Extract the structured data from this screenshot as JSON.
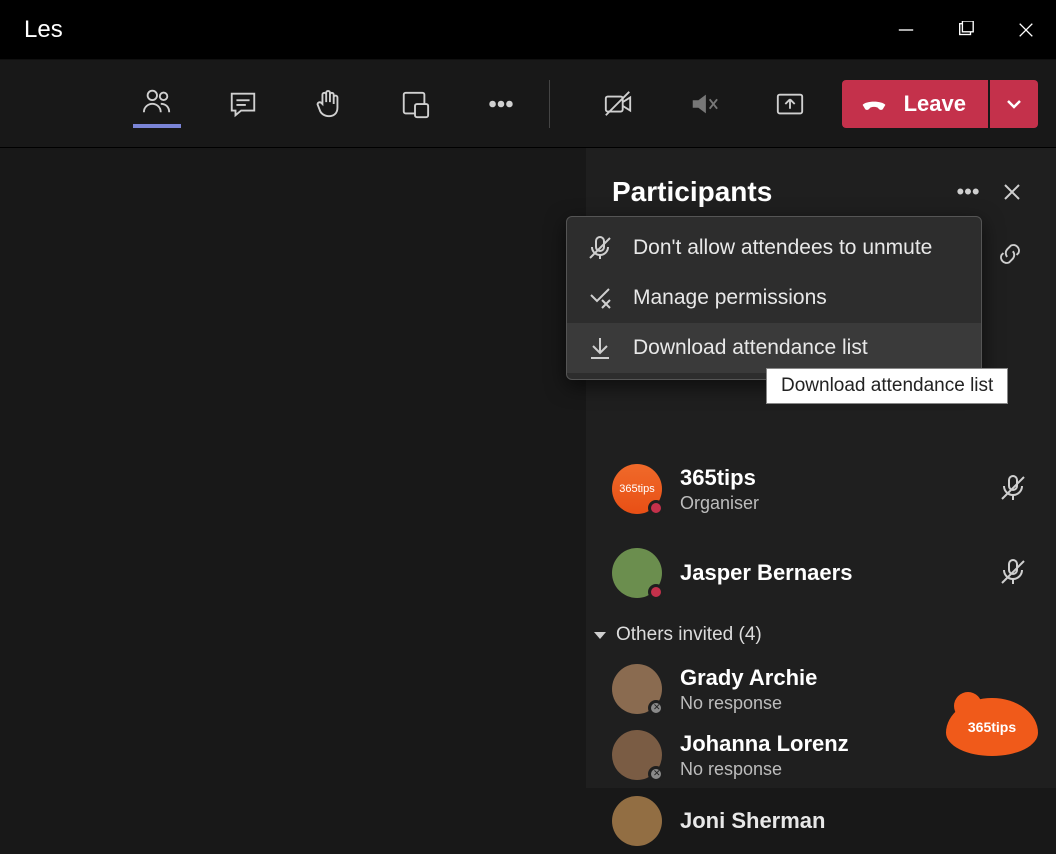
{
  "window": {
    "title": "Les"
  },
  "toolbar": {
    "leave_label": "Leave"
  },
  "panel": {
    "title": "Participants",
    "menu": {
      "mute_attendees": "Don't allow attendees to unmute",
      "manage_permissions": "Manage permissions",
      "download_attendance": "Download attendance list"
    },
    "tooltip": "Download attendance list",
    "participants": [
      {
        "name": "365tips",
        "role": "Organiser",
        "status": "busy",
        "muted": true
      },
      {
        "name": "Jasper Bernaers",
        "status": "busy",
        "muted": true
      }
    ],
    "invited_header": "Others invited (4)",
    "invited": [
      {
        "name": "Grady Archie",
        "note": "No response"
      },
      {
        "name": "Johanna Lorenz",
        "note": "No response"
      },
      {
        "name": "Joni Sherman"
      }
    ]
  },
  "brand": "365tips"
}
